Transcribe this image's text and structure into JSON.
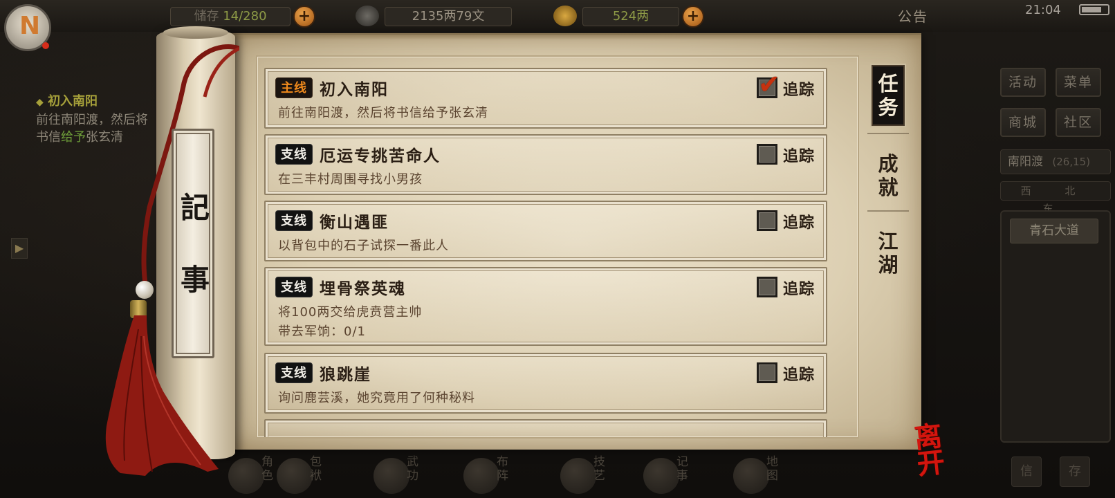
{
  "hud": {
    "storage": "14/280",
    "storage_label": "储存",
    "silver": "2135两79文",
    "gold": "524两",
    "notice": "公告",
    "time": "21:04",
    "plus": "+"
  },
  "avatar": {
    "glyph": "N"
  },
  "tracked_quest": {
    "title": "初入南阳",
    "line1": "前往南阳渡，然后将",
    "line2_a": "书信",
    "line2_b": "给予",
    "line2_c": "张玄清"
  },
  "right_menu": {
    "activity": "活动",
    "menu": "菜单",
    "shop": "商城",
    "community": "社区",
    "location": "南阳渡",
    "coords": "(26,15)",
    "compass": "西  北  东",
    "road": "青石大道",
    "bottom1": "信",
    "bottom2": "存"
  },
  "bottom_bar": [
    "角色",
    "包袱",
    "武功",
    "布阵",
    "技艺",
    "记事",
    "地图"
  ],
  "scroll": {
    "title_chars": [
      "記",
      "事"
    ],
    "leave_label": "离开"
  },
  "tabs": [
    {
      "label": "任务",
      "active": true
    },
    {
      "label": "成就",
      "active": false
    },
    {
      "label": "江湖",
      "active": false
    }
  ],
  "quests": [
    {
      "tag": "主线",
      "type": "main",
      "title": "初入南阳",
      "desc": [
        "前往南阳渡，然后将书信给予张玄清"
      ],
      "tracked": true,
      "track_label": "追踪"
    },
    {
      "tag": "支线",
      "type": "side",
      "title": "厄运专挑苦命人",
      "desc": [
        "在三丰村周围寻找小男孩"
      ],
      "tracked": false,
      "track_label": "追踪"
    },
    {
      "tag": "支线",
      "type": "side",
      "title": "衡山遇匪",
      "desc": [
        "以背包中的石子试探一番此人"
      ],
      "tracked": false,
      "track_label": "追踪"
    },
    {
      "tag": "支线",
      "type": "side",
      "title": "埋骨祭英魂",
      "desc": [
        "将100两交给虎贲营主帅",
        "带去军饷：0/1"
      ],
      "tracked": false,
      "track_label": "追踪"
    },
    {
      "tag": "支线",
      "type": "side",
      "title": "狼跳崖",
      "desc": [
        "询问鹿芸溪，她究竟用了何种秘料"
      ],
      "tracked": false,
      "track_label": "追踪"
    }
  ],
  "colors": {
    "main_tag": "#f08a1c",
    "check": "#c5320f",
    "leave": "#d3150e",
    "tassel": "#8e1a12"
  }
}
